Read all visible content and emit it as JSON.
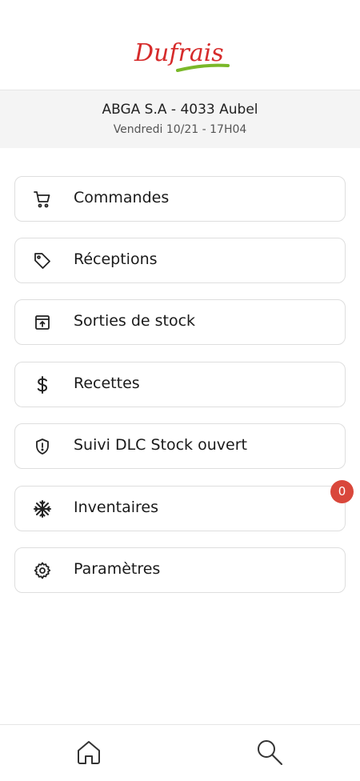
{
  "header": {
    "logo_text": "Dufrais",
    "company": "ABGA S.A - 4033 Aubel",
    "datetime": "Vendredi 10/21 - 17H04",
    "brand_red": "#d62b2b",
    "brand_green": "#7ab829"
  },
  "menu": {
    "items": [
      {
        "label": "Commandes",
        "icon": "cart-icon"
      },
      {
        "label": "Réceptions",
        "icon": "tag-icon"
      },
      {
        "label": "Sorties de stock",
        "icon": "archive-upload-icon"
      },
      {
        "label": "Recettes",
        "icon": "dollar-icon"
      },
      {
        "label": "Suivi DLC Stock ouvert",
        "icon": "shield-alert-icon"
      },
      {
        "label": "Inventaires",
        "icon": "snowflake-icon",
        "badge": "0"
      },
      {
        "label": "Paramètres",
        "icon": "gear-icon"
      }
    ]
  },
  "bottom_nav": {
    "items": [
      {
        "icon": "home-icon"
      },
      {
        "icon": "search-icon"
      }
    ]
  },
  "colors": {
    "badge": "#d9473b",
    "info_bar": "#f4f4f4"
  }
}
